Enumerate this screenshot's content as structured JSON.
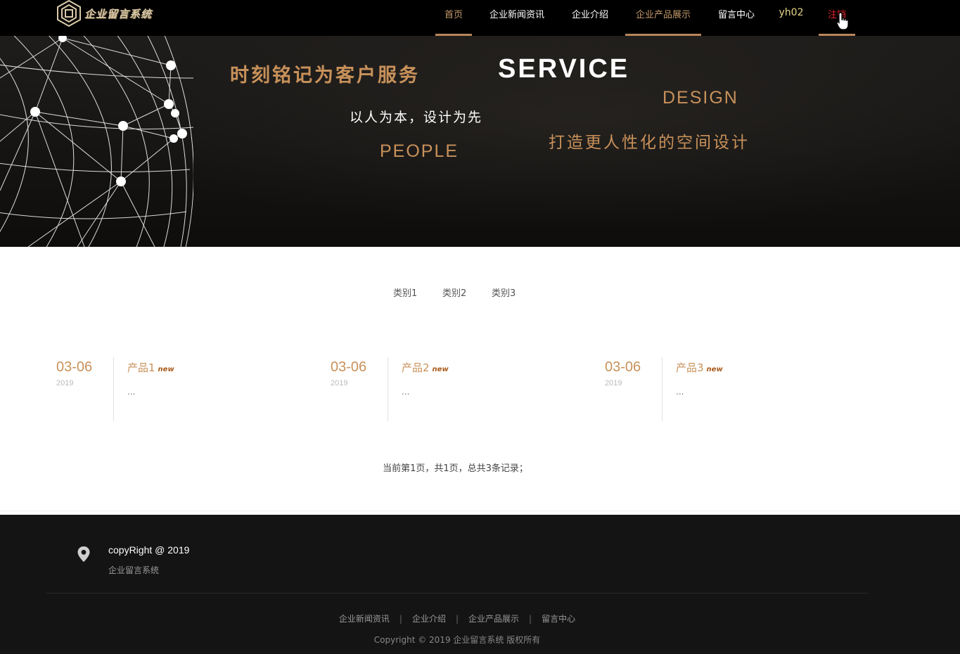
{
  "header": {
    "logo_text": "企业留言系统",
    "nav": [
      {
        "label": "首页",
        "active": true
      },
      {
        "label": "企业新闻资讯",
        "active": false
      },
      {
        "label": "企业介绍",
        "active": false
      },
      {
        "label": "企业产品展示",
        "active": true
      },
      {
        "label": "留言中心",
        "active": false
      }
    ],
    "username": "yh02",
    "logout_label": "注销"
  },
  "banner": {
    "line1": "时刻铭记为客户服务",
    "line2": "SERVICE",
    "line3": "DESIGN",
    "line4": "以人为本，设计为先",
    "line5": "打造更人性化的空间设计",
    "line6": "PEOPLE"
  },
  "categories": [
    "类别1",
    "类别2",
    "类别3"
  ],
  "products": [
    {
      "date": "03-06",
      "year": "2019",
      "title": "产品1",
      "badge": "new",
      "desc": "..."
    },
    {
      "date": "03-06",
      "year": "2019",
      "title": "产品2",
      "badge": "new",
      "desc": "..."
    },
    {
      "date": "03-06",
      "year": "2019",
      "title": "产品3",
      "badge": "new",
      "desc": "..."
    }
  ],
  "pagination": "当前第1页，共1页，总共3条记录；",
  "footer": {
    "copyright": "copyRight @ 2019",
    "company": "企业留言系统",
    "links": [
      "企业新闻资讯",
      "企业介绍",
      "企业产品展示",
      "留言中心"
    ],
    "rights": "Copyright © 2019 企业留言系统 版权所有"
  },
  "colors": {
    "accent": "#c8915a",
    "logout": "#e2242b",
    "username": "#e8d58a",
    "footer_bg": "#141414"
  }
}
